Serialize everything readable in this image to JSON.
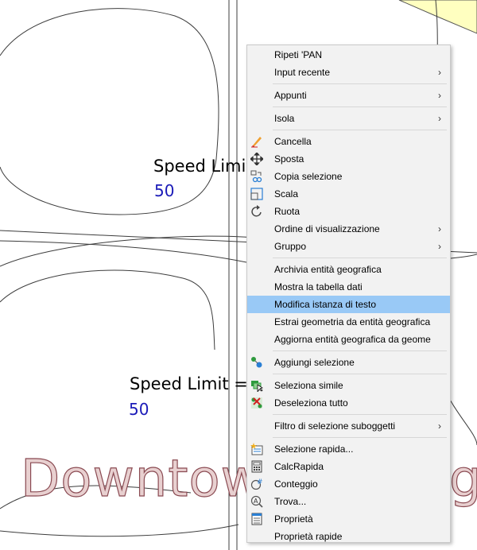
{
  "map": {
    "label_1": "Speed Limit",
    "value_1": "50",
    "label_2": "Speed Limit =",
    "value_2": "50",
    "district_left": "Downtow",
    "district_right": "g"
  },
  "menu": {
    "items": [
      {
        "label": "Ripeti 'PAN",
        "submenu": false
      },
      {
        "label": "Input recente",
        "submenu": true
      },
      {
        "label": "Appunti",
        "submenu": true
      },
      {
        "label": "Isola",
        "submenu": true
      },
      {
        "label": "Cancella",
        "icon": "eraser-icon"
      },
      {
        "label": "Sposta",
        "icon": "move-icon"
      },
      {
        "label": "Copia selezione",
        "icon": "copy-selection-icon"
      },
      {
        "label": "Scala",
        "icon": "scale-icon"
      },
      {
        "label": "Ruota",
        "icon": "rotate-icon"
      },
      {
        "label": "Ordine di visualizzazione",
        "submenu": true
      },
      {
        "label": "Gruppo",
        "submenu": true
      },
      {
        "label": "Archivia entità geografica"
      },
      {
        "label": "Mostra la tabella dati"
      },
      {
        "label": "Modifica istanza di testo",
        "highlighted": true
      },
      {
        "label": "Estrai geometria da entità geografica"
      },
      {
        "label": "Aggiorna entità geografica da geome"
      },
      {
        "label": "Aggiungi selezione",
        "icon": "add-selected-icon"
      },
      {
        "label": "Seleziona simile",
        "icon": "select-similar-icon"
      },
      {
        "label": "Deseleziona tutto",
        "icon": "deselect-all-icon"
      },
      {
        "label": "Filtro di selezione suboggetti",
        "submenu": true
      },
      {
        "label": "Selezione rapida...",
        "icon": "quick-select-icon"
      },
      {
        "label": "CalcRapida",
        "icon": "calculator-icon"
      },
      {
        "label": "Conteggio",
        "icon": "count-icon"
      },
      {
        "label": "Trova...",
        "icon": "find-icon"
      },
      {
        "label": "Proprietà",
        "icon": "properties-icon"
      },
      {
        "label": "Proprietà rapide"
      }
    ],
    "submenu_arrow": "›",
    "colors": {
      "highlight": "#99c9f6",
      "background": "#f2f2f2"
    }
  }
}
